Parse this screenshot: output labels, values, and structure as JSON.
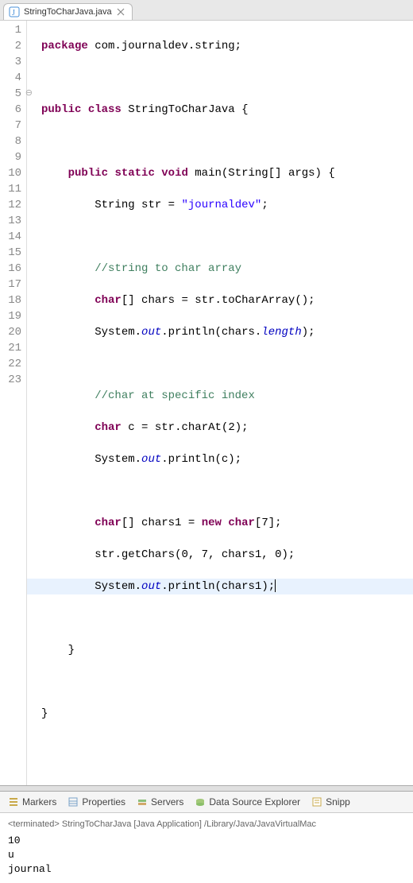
{
  "tab": {
    "filename": "StringToCharJava.java"
  },
  "code": {
    "package_kw": "package",
    "package_name": "com.journaldev.string;",
    "public_kw": "public",
    "class_kw": "class",
    "class_name": "StringToCharJava",
    "static_kw": "static",
    "void_kw": "void",
    "main_name": "main",
    "string_type": "String",
    "args_name": "args",
    "str_var": "str",
    "str_literal": "\"journaldev\"",
    "comment1": "//string to char array",
    "char_kw": "char",
    "chars_var": "chars",
    "toCharArray": "toCharArray",
    "system": "System",
    "out": "out",
    "println": "println",
    "length": "length",
    "comment2": "//char at specific index",
    "c_var": "c",
    "charAt": "charAt",
    "charAt_arg": "2",
    "chars1_var": "chars1",
    "new_kw": "new",
    "arr_size": "7",
    "getChars": "getChars",
    "getChars_args": "0, 7, chars1, 0",
    "line_numbers": [
      "1",
      "2",
      "3",
      "4",
      "5",
      "6",
      "7",
      "8",
      "9",
      "10",
      "11",
      "12",
      "13",
      "14",
      "15",
      "16",
      "17",
      "18",
      "19",
      "20",
      "21",
      "22",
      "23"
    ]
  },
  "views": {
    "markers": "Markers",
    "properties": "Properties",
    "servers": "Servers",
    "dataSource": "Data Source Explorer",
    "snippets": "Snipp"
  },
  "console": {
    "header": "<terminated> StringToCharJava [Java Application] /Library/Java/JavaVirtualMac",
    "out1": "10",
    "out2": "u",
    "out3": "journal"
  }
}
